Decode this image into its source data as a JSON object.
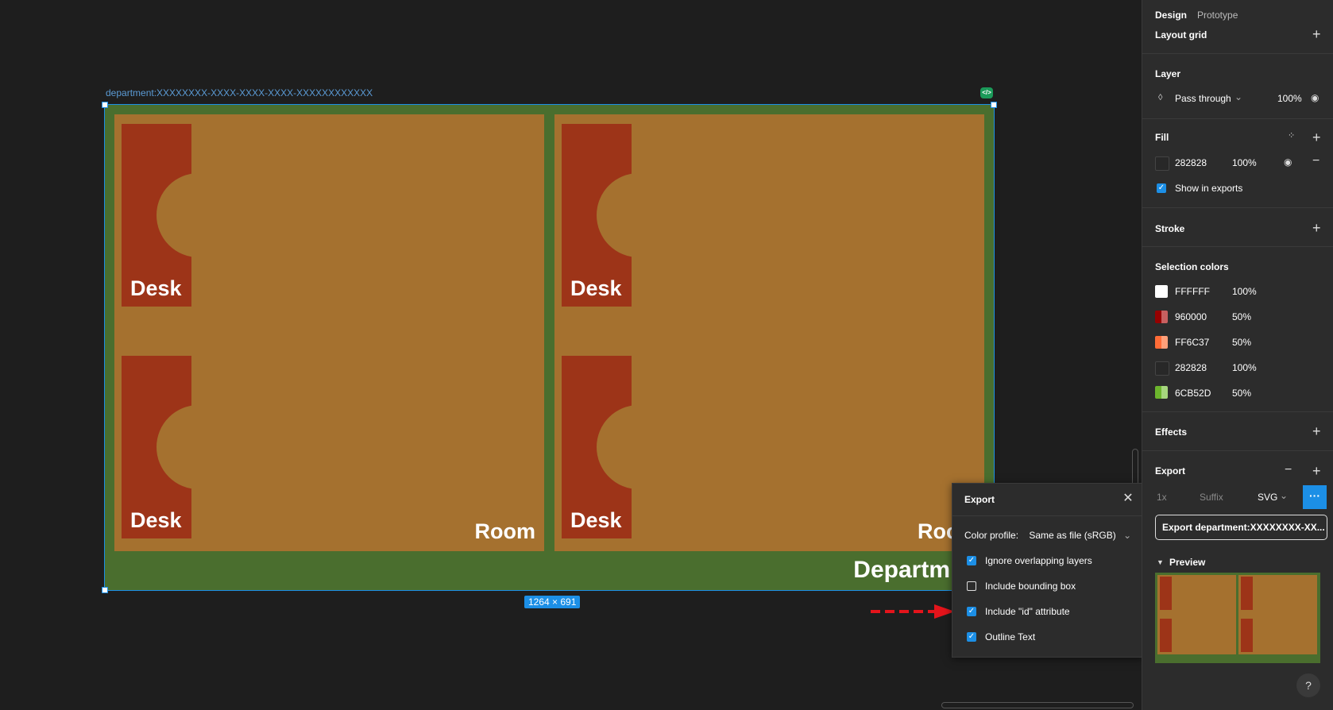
{
  "canvas": {
    "frame_name": "department:XXXXXXXX-XXXX-XXXX-XXXX-XXXXXXXXXXXX",
    "size_label": "1264 × 691",
    "desk_label": "Desk",
    "room_label": "Room",
    "room_label_partial": "Roo",
    "department_label_partial": "Departm"
  },
  "export_popup": {
    "title": "Export",
    "color_profile_label": "Color profile:",
    "color_profile_value": "Same as file (sRGB)",
    "options": [
      {
        "label": "Ignore overlapping layers",
        "checked": true
      },
      {
        "label": "Include bounding box",
        "checked": false
      },
      {
        "label": "Include \"id\" attribute",
        "checked": true
      },
      {
        "label": "Outline Text",
        "checked": true
      }
    ]
  },
  "panel": {
    "tabs": [
      "Design",
      "Prototype"
    ],
    "layout_grid": "Layout grid",
    "layer": {
      "title": "Layer",
      "blend": "Pass through",
      "opacity": "100%"
    },
    "fill": {
      "title": "Fill",
      "hex": "282828",
      "opacity": "100%",
      "show_in_exports": "Show in exports"
    },
    "stroke": "Stroke",
    "selection_colors": {
      "title": "Selection colors",
      "items": [
        {
          "hex": "FFFFFF",
          "opacity": "100%",
          "color": "#FFFFFF"
        },
        {
          "hex": "960000",
          "opacity": "50%",
          "color": "#960000"
        },
        {
          "hex": "FF6C37",
          "opacity": "50%",
          "color": "#FF6C37"
        },
        {
          "hex": "282828",
          "opacity": "100%",
          "color": "#282828"
        },
        {
          "hex": "6CB52D",
          "opacity": "50%",
          "color": "#6CB52D"
        }
      ]
    },
    "effects": "Effects",
    "export": {
      "title": "Export",
      "scale": "1x",
      "suffix": "Suffix",
      "format": "SVG",
      "button": "Export department:XXXXXXXX-XX...",
      "preview": "Preview"
    },
    "help": "?"
  },
  "colors": {
    "accent": "#1c8fe6",
    "frame_green": "#4a6e2e",
    "room": "#a5712f",
    "desk": "#9d3418"
  }
}
